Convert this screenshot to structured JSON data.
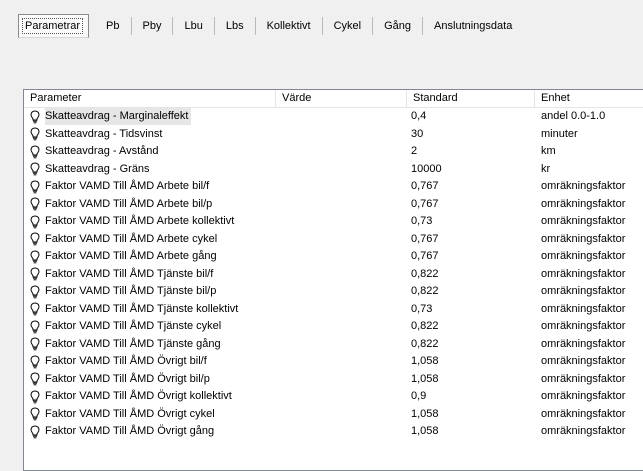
{
  "tabs": [
    {
      "label": "Parametrar",
      "active": true
    },
    {
      "label": "Pb"
    },
    {
      "label": "Pby"
    },
    {
      "label": "Lbu"
    },
    {
      "label": "Lbs"
    },
    {
      "label": "Kollektivt"
    },
    {
      "label": "Cykel"
    },
    {
      "label": "Gång"
    },
    {
      "label": "Anslutningsdata"
    }
  ],
  "columns": [
    "Parameter",
    "Värde",
    "Standard",
    "Enhet"
  ],
  "rows": [
    {
      "parameter": "Skatteavdrag - Marginaleffekt",
      "value": "",
      "standard": "0,4",
      "unit": "andel 0.0-1.0",
      "selected": true
    },
    {
      "parameter": "Skatteavdrag - Tidsvinst",
      "value": "",
      "standard": "30",
      "unit": "minuter"
    },
    {
      "parameter": "Skatteavdrag - Avstånd",
      "value": "",
      "standard": "2",
      "unit": "km"
    },
    {
      "parameter": "Skatteavdrag - Gräns",
      "value": "",
      "standard": "10000",
      "unit": "kr"
    },
    {
      "parameter": "Faktor VAMD Till ÅMD Arbete bil/f",
      "value": "",
      "standard": "0,767",
      "unit": "omräkningsfaktor"
    },
    {
      "parameter": "Faktor VAMD Till ÅMD Arbete bil/p",
      "value": "",
      "standard": "0,767",
      "unit": "omräkningsfaktor"
    },
    {
      "parameter": "Faktor VAMD Till ÅMD Arbete kollektivt",
      "value": "",
      "standard": "0,73",
      "unit": "omräkningsfaktor"
    },
    {
      "parameter": "Faktor VAMD Till ÅMD Arbete cykel",
      "value": "",
      "standard": "0,767",
      "unit": "omräkningsfaktor"
    },
    {
      "parameter": "Faktor VAMD Till ÅMD Arbete gång",
      "value": "",
      "standard": "0,767",
      "unit": "omräkningsfaktor"
    },
    {
      "parameter": "Faktor VAMD Till ÅMD Tjänste bil/f",
      "value": "",
      "standard": "0,822",
      "unit": "omräkningsfaktor"
    },
    {
      "parameter": "Faktor VAMD Till ÅMD Tjänste bil/p",
      "value": "",
      "standard": "0,822",
      "unit": "omräkningsfaktor"
    },
    {
      "parameter": "Faktor VAMD Till ÅMD Tjänste kollektivt",
      "value": "",
      "standard": "0,73",
      "unit": "omräkningsfaktor"
    },
    {
      "parameter": "Faktor VAMD Till ÅMD Tjänste cykel",
      "value": "",
      "standard": "0,822",
      "unit": "omräkningsfaktor"
    },
    {
      "parameter": "Faktor VAMD Till ÅMD Tjänste gång",
      "value": "",
      "standard": "0,822",
      "unit": "omräkningsfaktor"
    },
    {
      "parameter": "Faktor VAMD Till ÅMD Övrigt bil/f",
      "value": "",
      "standard": "1,058",
      "unit": "omräkningsfaktor"
    },
    {
      "parameter": "Faktor VAMD Till ÅMD Övrigt bil/p",
      "value": "",
      "standard": "1,058",
      "unit": "omräkningsfaktor"
    },
    {
      "parameter": "Faktor VAMD Till ÅMD Övrigt kollektivt",
      "value": "",
      "standard": "0,9",
      "unit": "omräkningsfaktor"
    },
    {
      "parameter": "Faktor VAMD Till ÅMD Övrigt cykel",
      "value": "",
      "standard": "1,058",
      "unit": "omräkningsfaktor"
    },
    {
      "parameter": "Faktor VAMD Till ÅMD Övrigt gång",
      "value": "",
      "standard": "1,058",
      "unit": "omräkningsfaktor"
    }
  ],
  "row_icon": "lightbulb-icon"
}
